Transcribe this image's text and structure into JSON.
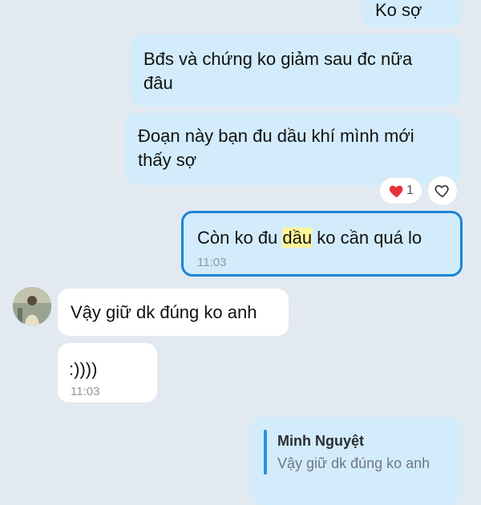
{
  "messages": [
    {
      "text": "Ko sợ"
    },
    {
      "text": "Bđs và chứng ko giảm sau đc nữa đâu"
    },
    {
      "text": "Đoạn này bạn đu dầu khí mình mới thấy sợ",
      "reaction_count": "1"
    },
    {
      "text_before": "Còn ko đu ",
      "highlight": "dầu",
      "text_after": " ko cần quá lo",
      "time": "11:03"
    },
    {
      "text": "Vậy giữ dk đúng ko anh"
    },
    {
      "text": ":))))",
      "time": "11:03"
    }
  ],
  "reply": {
    "author": "Minh Nguyệt",
    "quoted_text": "Vậy giữ dk đúng ko anh"
  },
  "colors": {
    "background": "#e2e9f1",
    "sent_bubble": "#d3ecfb",
    "received_bubble": "#ffffff",
    "selected_border": "#1b84d8",
    "highlight": "#fff59a",
    "heart": "#e8303a"
  }
}
